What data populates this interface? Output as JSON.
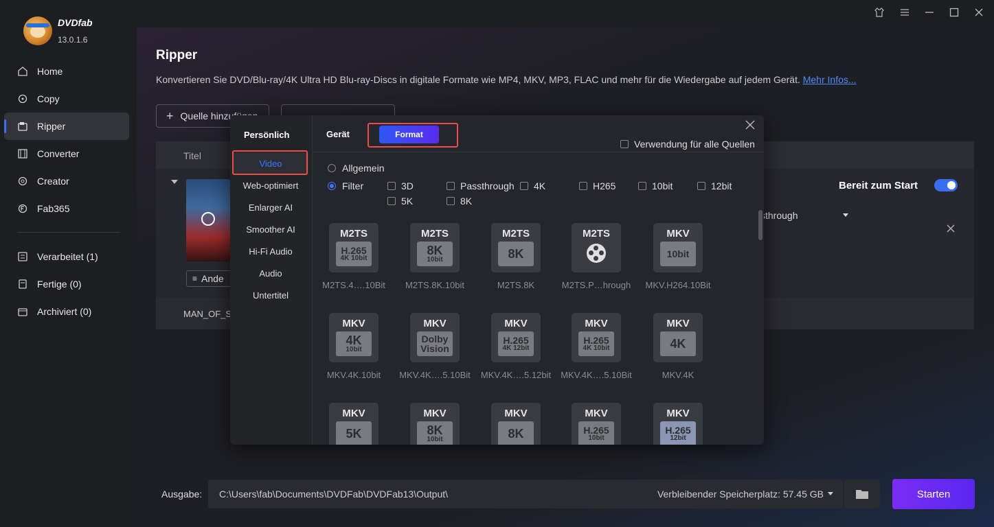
{
  "app": {
    "brand": "DVDfab",
    "version": "13.0.1.6"
  },
  "sidebar": {
    "items": [
      {
        "label": "Home",
        "icon": "home-icon"
      },
      {
        "label": "Copy",
        "icon": "copy-icon"
      },
      {
        "label": "Ripper",
        "icon": "ripper-icon",
        "active": true
      },
      {
        "label": "Converter",
        "icon": "converter-icon"
      },
      {
        "label": "Creator",
        "icon": "creator-icon"
      },
      {
        "label": "Fab365",
        "icon": "fab365-icon"
      }
    ],
    "queue": [
      {
        "label": "Verarbeitet (1)",
        "icon": "processed-icon"
      },
      {
        "label": "Fertige (0)",
        "icon": "finished-icon"
      },
      {
        "label": "Archiviert (0)",
        "icon": "archive-icon"
      }
    ]
  },
  "main": {
    "title": "Ripper",
    "description": "Konvertieren Sie DVD/Blu-ray/4K Ultra HD Blu-ray-Discs in digitale Formate wie MP4, MKV, MP3, FLAC und mehr für die Wiedergabe auf jedem Gerät.",
    "more_link": "Mehr Infos...",
    "add_source": "Quelle hinzufügen",
    "list": {
      "col_title": "Titel",
      "ready": "Bereit zum Start",
      "profile_value": "sthrough",
      "other_button": "Ande",
      "row2_text": "MAN_OF_S"
    },
    "output": {
      "label": "Ausgabe:",
      "path": "C:\\Users\\fab\\Documents\\DVDFab\\DVDFab13\\Output\\",
      "space": "Verbleibender Speicherplatz: 57.45 GB",
      "start": "Starten"
    }
  },
  "dialog": {
    "left_header": "Persönlich",
    "categories": [
      "Video",
      "Web-optimiert",
      "Enlarger AI",
      "Smoother AI",
      "Hi-Fi Audio",
      "Audio",
      "Untertitel"
    ],
    "tabs": {
      "device": "Gerät",
      "format": "Format"
    },
    "apply_all": "Verwendung für alle Quellen",
    "mode": {
      "general": "Allgemein",
      "filter": "Filter"
    },
    "filters": [
      "3D",
      "Passthrough",
      "4K",
      "H265",
      "10bit",
      "12bit",
      "5K",
      "8K"
    ],
    "formats": [
      {
        "top": "M2TS",
        "l1": "H.265",
        "l2": "4K 10bit",
        "label": "M2TS.4….10Bit"
      },
      {
        "top": "M2TS",
        "l1": "8K",
        "l2": "10bit",
        "label": "M2TS.8K.10bit"
      },
      {
        "top": "M2TS",
        "l1": "8K",
        "l2": "",
        "label": "M2TS.8K"
      },
      {
        "top": "M2TS",
        "l1": "",
        "l2": "",
        "reel": true,
        "label": "M2TS.P…hrough"
      },
      {
        "top": "MKV",
        "l1": "10bit",
        "l2": "",
        "label": "MKV.H264.10Bit"
      },
      {
        "top": "MKV",
        "l1": "4K",
        "l2": "10bit",
        "label": "MKV.4K.10bit"
      },
      {
        "top": "MKV",
        "l1": "Dolby",
        "l2": "Vision",
        "label": "MKV.4K….5.10Bit"
      },
      {
        "top": "MKV",
        "l1": "H.265",
        "l2": "4K 12bit",
        "label": "MKV.4K….5.12bit"
      },
      {
        "top": "MKV",
        "l1": "H.265",
        "l2": "4K 10bit",
        "label": "MKV.4K….5.10Bit"
      },
      {
        "top": "MKV",
        "l1": "4K",
        "l2": "",
        "label": "MKV.4K"
      },
      {
        "top": "MKV",
        "l1": "5K",
        "l2": "",
        "label": ""
      },
      {
        "top": "MKV",
        "l1": "8K",
        "l2": "10bit",
        "label": ""
      },
      {
        "top": "MKV",
        "l1": "8K",
        "l2": "",
        "label": ""
      },
      {
        "top": "MKV",
        "l1": "H.265",
        "l2": "10bit",
        "label": ""
      },
      {
        "top": "MKV",
        "l1": "H.265",
        "l2": "12bit",
        "label": ""
      }
    ]
  },
  "colors": {
    "accent": "#3b78ff",
    "highlight": "#e84d4d",
    "start_button": "#6a2af3"
  }
}
